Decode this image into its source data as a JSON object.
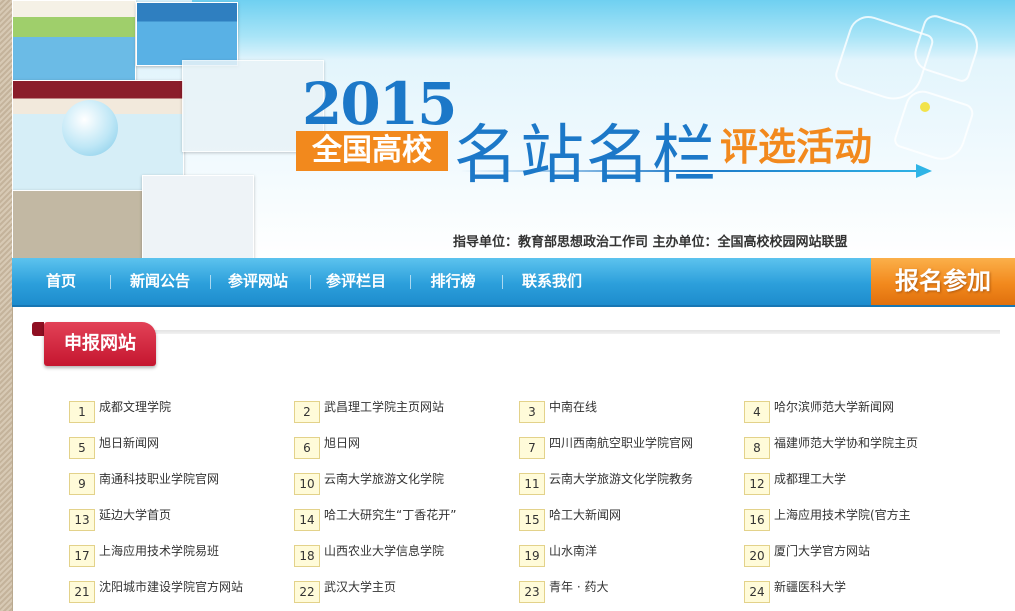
{
  "banner": {
    "year": "2015",
    "badge": "全国高校",
    "title": "名站名栏",
    "subtitle": "评选活动",
    "sponsor_line": "指导单位：教育部思想政治工作司   主办单位：全国高校校园网站联盟"
  },
  "nav": {
    "items": [
      {
        "label": "首页"
      },
      {
        "label": "新闻公告"
      },
      {
        "label": "参评网站"
      },
      {
        "label": "参评栏目"
      },
      {
        "label": "排行榜"
      },
      {
        "label": "联系我们"
      }
    ],
    "signup_label": "报名参加"
  },
  "section": {
    "title": "申报网站"
  },
  "sites": [
    {
      "num": "1",
      "name": "成都文理学院"
    },
    {
      "num": "2",
      "name": "武昌理工学院主页网站"
    },
    {
      "num": "3",
      "name": "中南在线"
    },
    {
      "num": "4",
      "name": "哈尔滨师范大学新闻网"
    },
    {
      "num": "5",
      "name": "旭日新闻网"
    },
    {
      "num": "6",
      "name": "旭日网"
    },
    {
      "num": "7",
      "name": "四川西南航空职业学院官网"
    },
    {
      "num": "8",
      "name": "福建师范大学协和学院主页"
    },
    {
      "num": "9",
      "name": "南通科技职业学院官网"
    },
    {
      "num": "10",
      "name": "云南大学旅游文化学院"
    },
    {
      "num": "11",
      "name": "云南大学旅游文化学院教务"
    },
    {
      "num": "12",
      "name": "成都理工大学"
    },
    {
      "num": "13",
      "name": "延边大学首页"
    },
    {
      "num": "14",
      "name": "哈工大研究生“丁香花开”"
    },
    {
      "num": "15",
      "name": "哈工大新闻网"
    },
    {
      "num": "16",
      "name": "上海应用技术学院(官方主"
    },
    {
      "num": "17",
      "name": "上海应用技术学院易班"
    },
    {
      "num": "18",
      "name": "山西农业大学信息学院"
    },
    {
      "num": "19",
      "name": "山水南洋"
    },
    {
      "num": "20",
      "name": "厦门大学官方网站"
    },
    {
      "num": "21",
      "name": "沈阳城市建设学院官方网站"
    },
    {
      "num": "22",
      "name": "武汉大学主页"
    },
    {
      "num": "23",
      "name": "青年 · 药大"
    },
    {
      "num": "24",
      "name": "新疆医科大学"
    }
  ],
  "colors": {
    "nav_blue": "#2c9fdb",
    "accent_orange": "#f2891d",
    "title_blue": "#1c78c8",
    "section_red": "#c5162f"
  }
}
